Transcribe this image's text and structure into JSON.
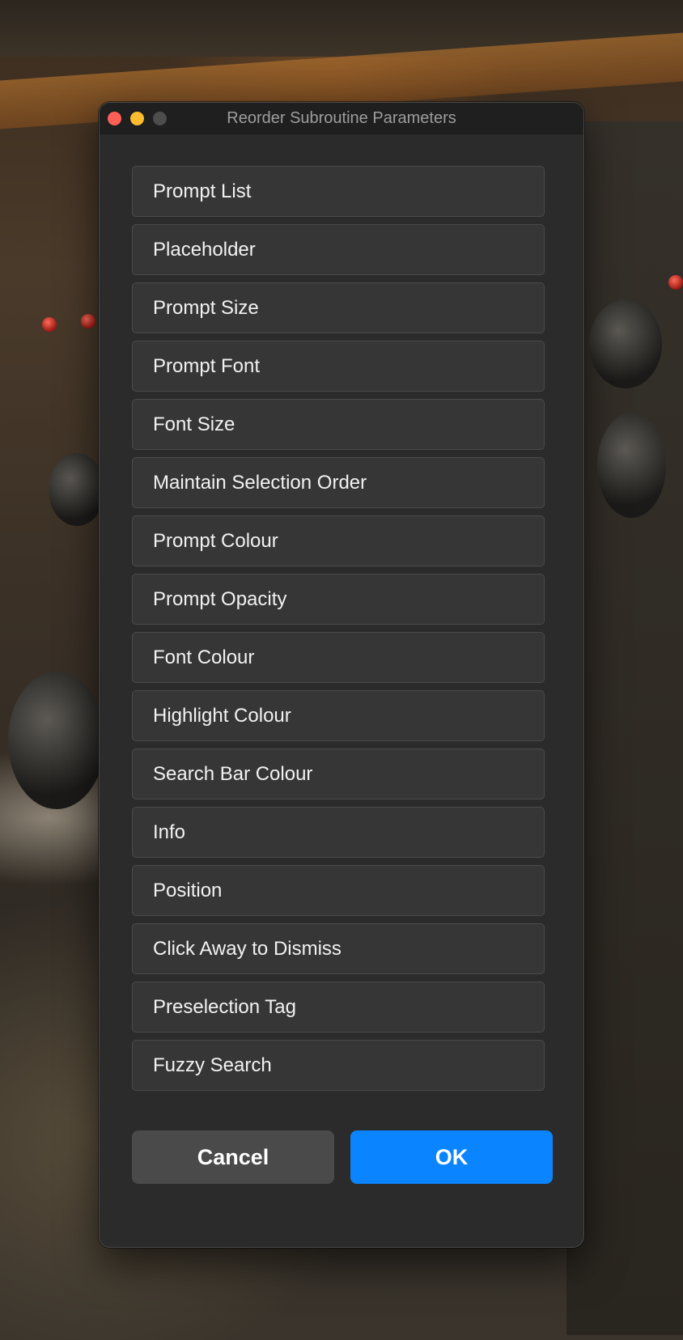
{
  "window": {
    "title": "Reorder Subroutine Parameters",
    "traffic_lights": {
      "close_color": "#ff5f57",
      "minimize_color": "#febc2e",
      "zoom_color": "#4d4d4d"
    }
  },
  "parameters": [
    "Prompt List",
    "Placeholder",
    "Prompt Size",
    "Prompt Font",
    "Font Size",
    "Maintain Selection Order",
    "Prompt Colour",
    "Prompt Opacity",
    "Font Colour",
    "Highlight Colour",
    "Search Bar Colour",
    "Info",
    "Position",
    "Click Away to Dismiss",
    "Preselection Tag",
    "Fuzzy Search"
  ],
  "buttons": {
    "cancel_label": "Cancel",
    "ok_label": "OK"
  },
  "colors": {
    "accent": "#0a84ff",
    "dialog_background": "#2b2b2b",
    "item_background": "#363636"
  }
}
